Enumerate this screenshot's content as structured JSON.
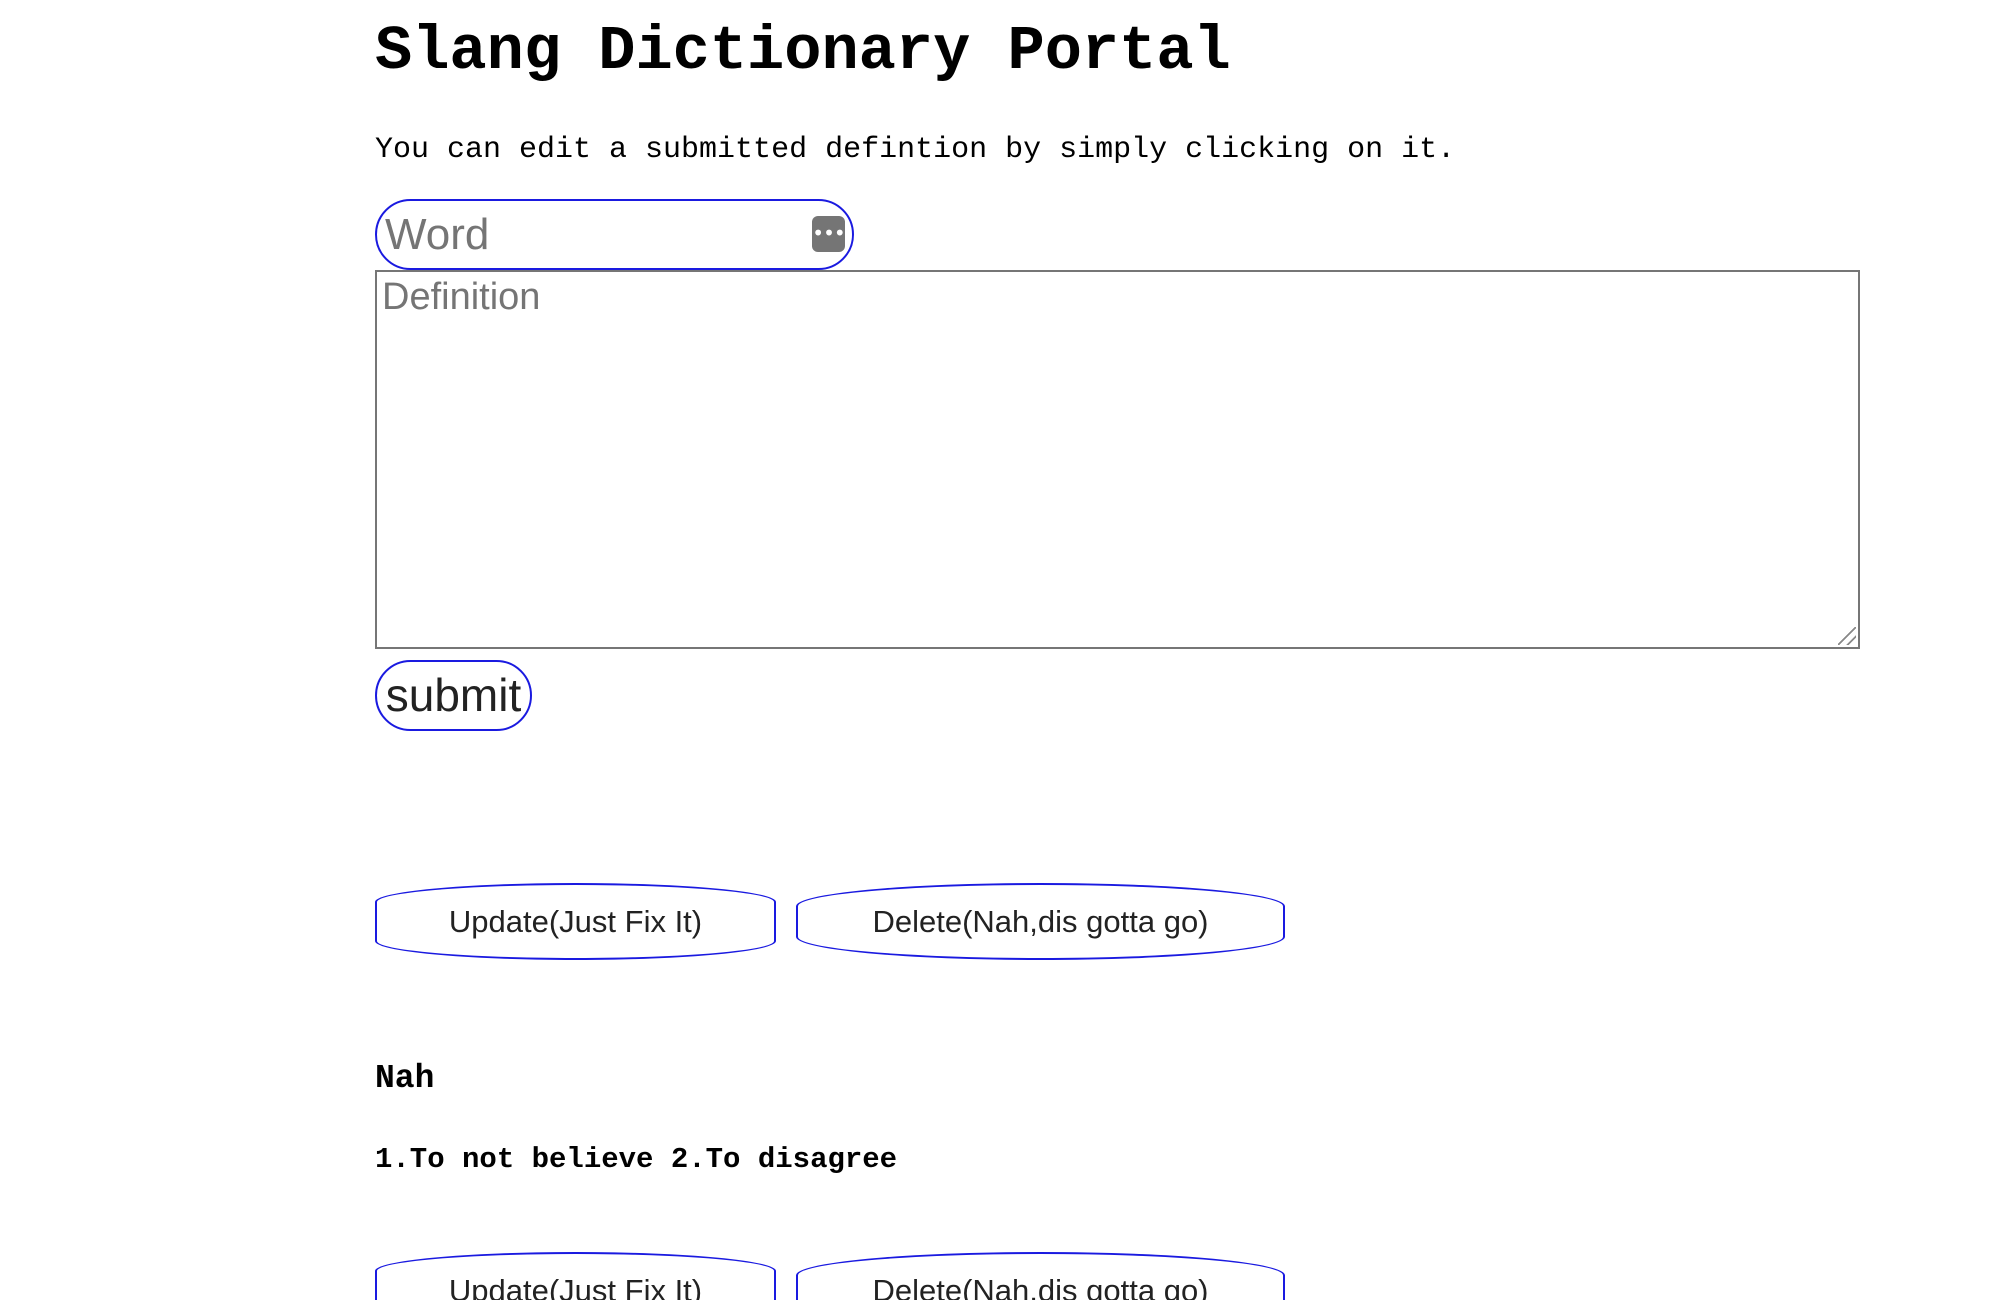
{
  "header": {
    "title": "Slang Dictionary Portal",
    "instructions": "You can edit a submitted defintion by simply clicking on it."
  },
  "form": {
    "word_placeholder": "Word",
    "word_value": "",
    "autofill_icon": "ellipsis-icon",
    "definition_placeholder": "Definition",
    "definition_value": "",
    "submit_label": "submit"
  },
  "entry_controls": [
    {
      "update_label": "Update(Just Fix It)",
      "delete_label": "Delete(Nah,dis gotta go)"
    },
    {
      "update_label": "Update(Just Fix It)",
      "delete_label": "Delete(Nah,dis gotta go)"
    }
  ],
  "entries": [
    {
      "word": "Nah",
      "definition": "1.To not believe 2.To disagree"
    }
  ],
  "colors": {
    "button_border": "#1a1ae0",
    "placeholder": "#757575",
    "text": "#000000"
  }
}
